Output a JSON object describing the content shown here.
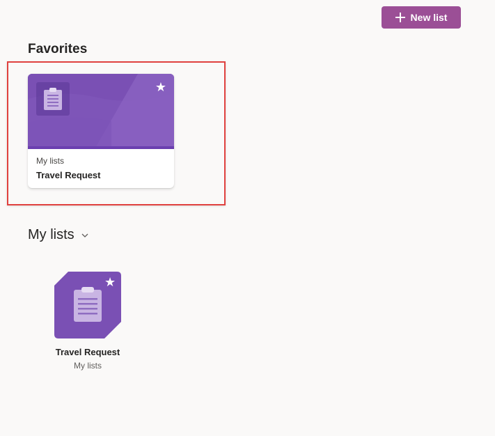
{
  "toolbar": {
    "new_list_label": "New list",
    "new_list_color": "#9b4f96"
  },
  "favorites": {
    "title": "Favorites",
    "cards": [
      {
        "category": "My lists",
        "name": "Travel Request",
        "icon": "clipboard-list-icon",
        "starred": true,
        "color": "#7a50b4"
      }
    ]
  },
  "my_lists": {
    "title": "My lists",
    "items": [
      {
        "name": "Travel Request",
        "category": "My lists",
        "icon": "clipboard-list-icon",
        "starred": true,
        "color": "#7a50b4"
      }
    ]
  },
  "icons": {
    "star": "★"
  },
  "highlight_color": "#e0413f"
}
